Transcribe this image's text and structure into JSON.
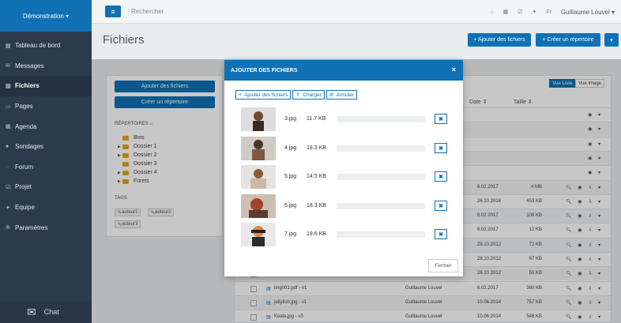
{
  "sidebar": {
    "brand": "Démonstration ▾",
    "items": [
      {
        "icon": "grid-icon",
        "glyph": "▦",
        "label": "Tableau de bord"
      },
      {
        "icon": "envelope-icon",
        "glyph": "✉",
        "label": "Messages"
      },
      {
        "icon": "file-icon",
        "glyph": "▤",
        "label": "Fichiers"
      },
      {
        "icon": "pages-icon",
        "glyph": "▭",
        "label": "Pages"
      },
      {
        "icon": "calendar-icon",
        "glyph": "▦",
        "label": "Agenda"
      },
      {
        "icon": "question-icon",
        "glyph": "●",
        "label": "Sondages"
      },
      {
        "icon": "forum-icon",
        "glyph": "◌",
        "label": "Forum"
      },
      {
        "icon": "checkbox-icon",
        "glyph": "☑",
        "label": "Projet"
      },
      {
        "icon": "team-icon",
        "glyph": "✦",
        "label": "Equipe"
      },
      {
        "icon": "gear-icon",
        "glyph": "✲",
        "label": "Paramètres"
      }
    ],
    "chat_label": "Chat"
  },
  "topbar": {
    "menu_glyph": "≡",
    "search_placeholder": "Rechercher",
    "lang": "Fr",
    "user": "Guillaume Louvel ▾"
  },
  "page": {
    "title": "Fichiers",
    "add_files_btn": "+ Ajouter des fichiers",
    "create_dir_btn": "+ Créer un répertoire",
    "more_btn": "▾"
  },
  "left_panel": {
    "add_files": "Ajouter des fichiers",
    "create_dir": "Créer un répertoire",
    "dirs_label": "RÉPERTOIRES",
    "tree": [
      "Bois",
      "Dossier 1",
      "Dossier 2",
      "Dossier 3",
      "Dossier 4",
      "Forets"
    ],
    "tags_label": "TAGS",
    "tags": [
      "auteur1",
      "auteur2",
      "auteur3"
    ]
  },
  "right_panel": {
    "view_list": "Vue Liste",
    "view_image": "Vue Image",
    "col_date": "Date ⇕",
    "col_size": "Taille ⇕",
    "rows": [
      {
        "name": "",
        "author": "",
        "date": "",
        "size": ""
      },
      {
        "name": "",
        "author": "",
        "date": "",
        "size": ""
      },
      {
        "name": "",
        "author": "",
        "date": "",
        "size": ""
      },
      {
        "name": "",
        "author": "",
        "date": "",
        "size": ""
      },
      {
        "name": "",
        "author": "",
        "date": "",
        "size": ""
      },
      {
        "name": "",
        "author": "",
        "date": "6.02.2017",
        "size": "4 MB"
      },
      {
        "name": "",
        "author": "",
        "date": "26.10.2016",
        "size": "453 KB"
      },
      {
        "name": "",
        "author": "",
        "date": "6.02.2017",
        "size": "108 KB"
      },
      {
        "name": "",
        "author": "",
        "date": "6.02.2017",
        "size": "12 KB"
      },
      {
        "name": "",
        "author": "",
        "date": "28.10.2012",
        "size": "72 KB"
      },
      {
        "name": "",
        "author": "",
        "date": "28.10.2012",
        "size": "67 KB"
      },
      {
        "name": "ID-10060473.jpg - v2",
        "author": "Eric Dubois",
        "date": "28.10.2012",
        "size": "58 KB"
      },
      {
        "name": "img001.pdf - v1",
        "author": "Guillaume Louvel",
        "date": "6.02.2017",
        "size": "380 KB"
      },
      {
        "name": "jellyfish.jpg - v1",
        "author": "Guillaume Louvel",
        "date": "10.06.2014",
        "size": "757 KB"
      },
      {
        "name": "Koala.jpg - v3",
        "author": "Guillaume Louvel",
        "date": "10.06.2014",
        "size": "548 KB"
      }
    ]
  },
  "modal": {
    "title": "AJOUTER DES FICHIERS",
    "close": "×",
    "btn_add": "Ajouter des fichiers",
    "btn_upload": "Charger",
    "btn_cancel": "Annuler",
    "files": [
      {
        "name": "3.jpg",
        "size": "11.7 KB",
        "progress": 0
      },
      {
        "name": "4.jpg",
        "size": "18.3 KB",
        "progress": 0
      },
      {
        "name": "5.jpg",
        "size": "14.5 KB",
        "progress": 0
      },
      {
        "name": "6.jpg",
        "size": "18.3 KB",
        "progress": 0
      },
      {
        "name": "7.jpg",
        "size": "19.6 KB",
        "progress": 0
      }
    ],
    "remove_glyph": "✖",
    "footer_close": "Fermer"
  },
  "colors": {
    "primary": "#0f71b4",
    "sidebar": "#2d3a4b",
    "folder": "#e2a71c"
  }
}
